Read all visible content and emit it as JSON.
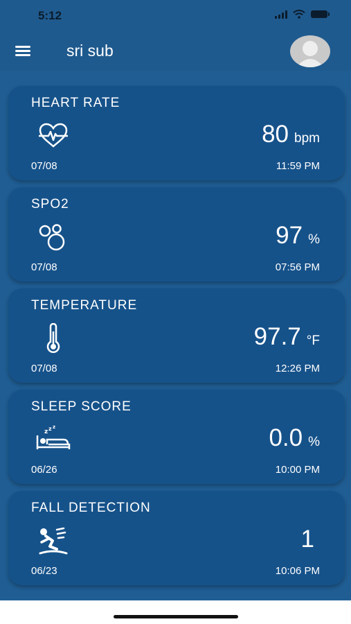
{
  "status_bar": {
    "time": "5:12"
  },
  "app_bar": {
    "title": "sri sub"
  },
  "cards": [
    {
      "title": "HEART RATE",
      "icon": "heart-pulse-icon",
      "value": "80",
      "unit": "bpm",
      "date": "07/08",
      "time": "11:59 PM"
    },
    {
      "title": "SPO2",
      "icon": "blood-oxygen-icon",
      "value": "97",
      "unit": "%",
      "date": "07/08",
      "time": "07:56 PM"
    },
    {
      "title": "TEMPERATURE",
      "icon": "thermometer-icon",
      "value": "97.7",
      "unit": "°F",
      "date": "07/08",
      "time": "12:26 PM"
    },
    {
      "title": "SLEEP SCORE",
      "icon": "sleep-bed-icon",
      "value": "0.0",
      "unit": "%",
      "date": "06/26",
      "time": "10:00 PM"
    },
    {
      "title": "FALL DETECTION",
      "icon": "fall-person-icon",
      "value": "1",
      "unit": "",
      "date": "06/23",
      "time": "10:06 PM"
    }
  ],
  "colors": {
    "background": "#1f5d93",
    "card": "#16528a",
    "text": "#ffffff"
  }
}
